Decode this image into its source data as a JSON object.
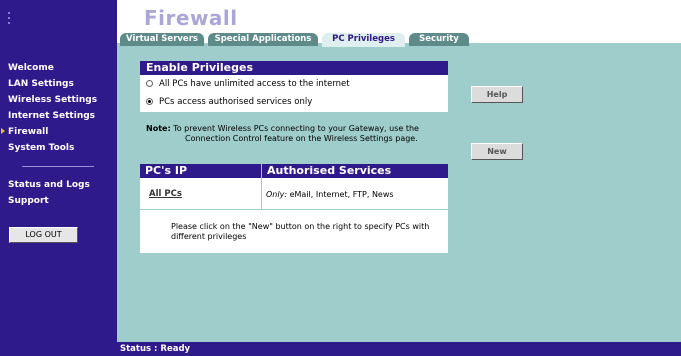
{
  "page": {
    "title": "Firewall"
  },
  "tabs": [
    {
      "label": "Virtual Servers",
      "active": false
    },
    {
      "label": "Special Applications",
      "active": false
    },
    {
      "label": "PC Privileges",
      "active": true
    },
    {
      "label": "Security",
      "active": false
    }
  ],
  "sidebar": {
    "items": [
      {
        "label": "Welcome",
        "active": false
      },
      {
        "label": "LAN Settings",
        "active": false
      },
      {
        "label": "Wireless Settings",
        "active": false
      },
      {
        "label": "Internet Settings",
        "active": false
      },
      {
        "label": "Firewall",
        "active": true
      },
      {
        "label": "System Tools",
        "active": false
      },
      {
        "label": "Status and Logs",
        "active": false
      },
      {
        "label": "Support",
        "active": false
      }
    ],
    "logout_label": "LOG OUT"
  },
  "privileges": {
    "heading": "Enable Privileges",
    "options": [
      {
        "label": "All PCs have unlimited access to the internet",
        "checked": false
      },
      {
        "label": "PCs access authorised services only",
        "checked": true
      }
    ]
  },
  "note": {
    "label": "Note:",
    "line1": "To prevent Wireless PCs connecting to your Gateway, use the",
    "line2": "Connection Control feature on the Wireless Settings page."
  },
  "table": {
    "headers": [
      "PC's IP Address(es)",
      "Authorised Services"
    ],
    "rows": [
      {
        "ip": "All PCs",
        "prefix": "Only:",
        "services": "eMail, Internet, FTP, News"
      }
    ],
    "message": "Please click on the \"New\" button on the right to specify PCs with different privileges"
  },
  "buttons": {
    "help": "Help",
    "new": "New"
  },
  "status": {
    "text": "Status : Ready"
  },
  "colors": {
    "sidebar": "#2e1a8a",
    "content": "#9fcdcc",
    "header": "#2e1a8a",
    "active_arrow": "#f0c020"
  }
}
